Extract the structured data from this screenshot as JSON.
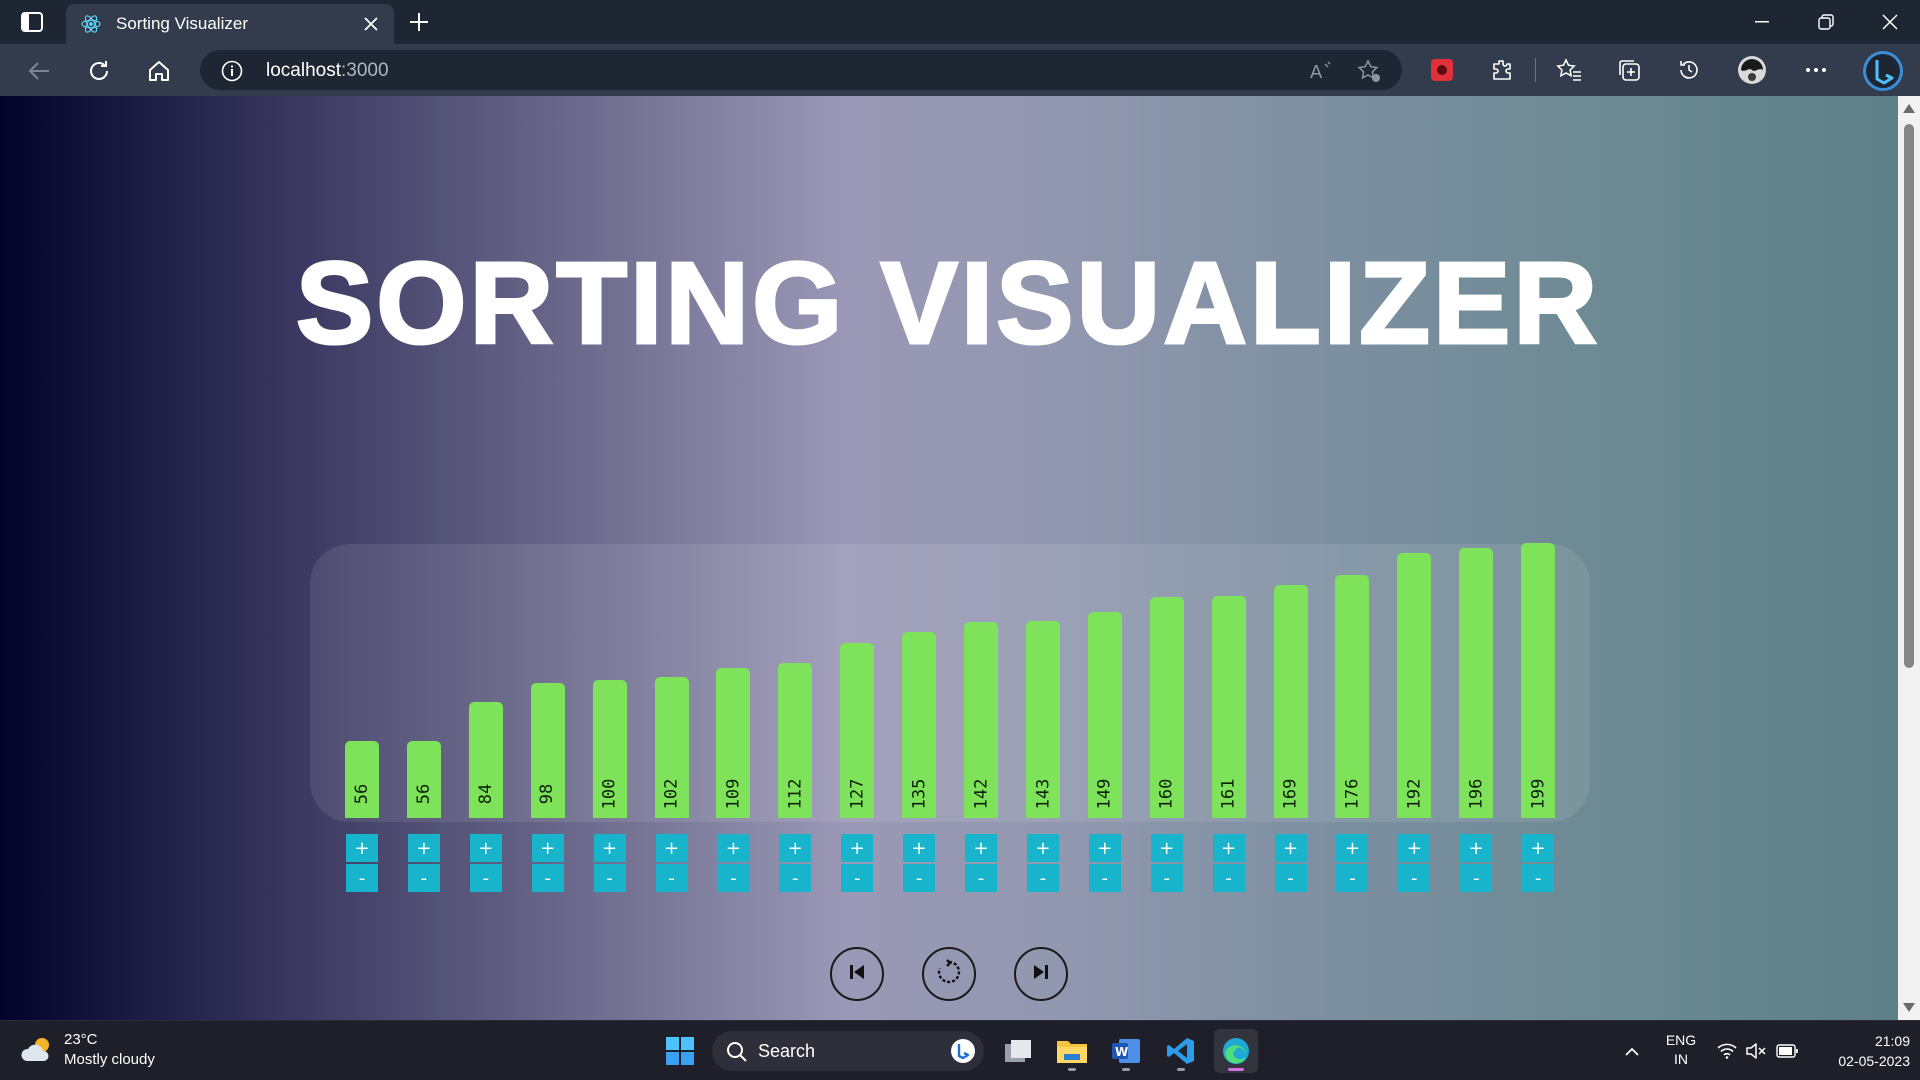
{
  "browser": {
    "tab_title": "Sorting Visualizer",
    "url_host": "localhost",
    "url_port": ":3000"
  },
  "page": {
    "title": "SORTING VISUALIZER",
    "increment_label": "+",
    "decrement_label": "-"
  },
  "chart_data": {
    "type": "bar",
    "values": [
      56,
      56,
      84,
      98,
      100,
      102,
      109,
      112,
      127,
      135,
      142,
      143,
      149,
      160,
      161,
      169,
      176,
      192,
      196,
      199
    ],
    "bar_color": "#7ee25a"
  },
  "controls": {
    "button_color": "#18b4cb",
    "player": [
      "step-backward-icon",
      "reset-icon",
      "step-forward-icon"
    ]
  },
  "taskbar": {
    "weather_temp": "23°C",
    "weather_desc": "Mostly cloudy",
    "search_label": "Search",
    "lang_line1": "ENG",
    "lang_line2": "IN",
    "time": "21:09",
    "date": "02-05-2023"
  }
}
